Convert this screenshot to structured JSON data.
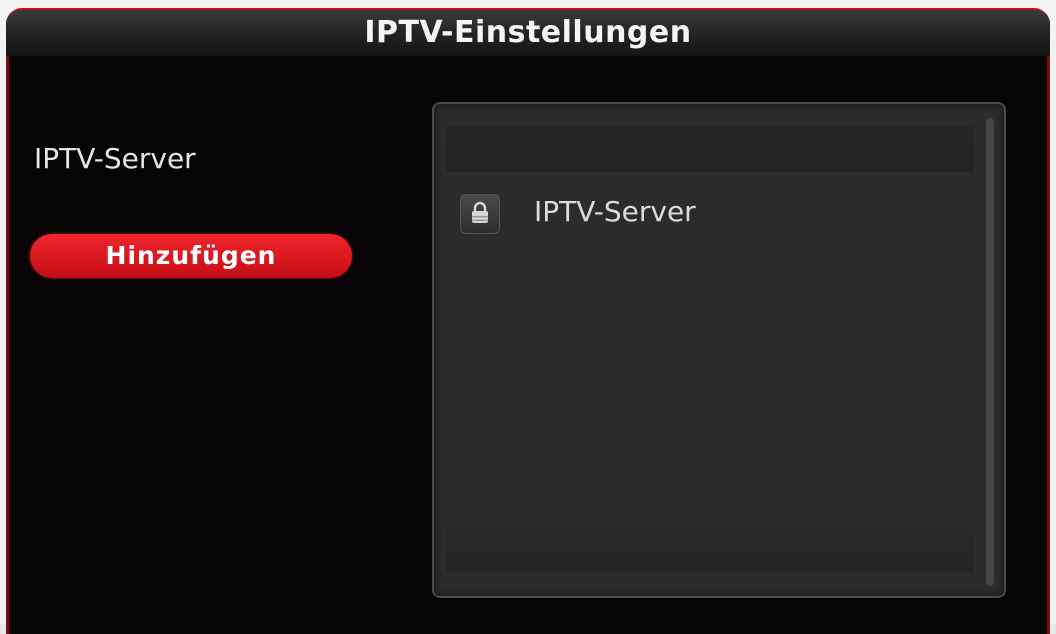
{
  "window": {
    "title": "IPTV-Einstellungen"
  },
  "left_panel": {
    "label": "IPTV-Server",
    "add_button_label": "Hinzufügen"
  },
  "list": {
    "items": [
      {
        "label": "IPTV-Server",
        "icon": "lock-icon"
      }
    ]
  },
  "colors": {
    "accent_red": "#e1191f",
    "background": "#060405",
    "panel": "#2c2c2c"
  }
}
